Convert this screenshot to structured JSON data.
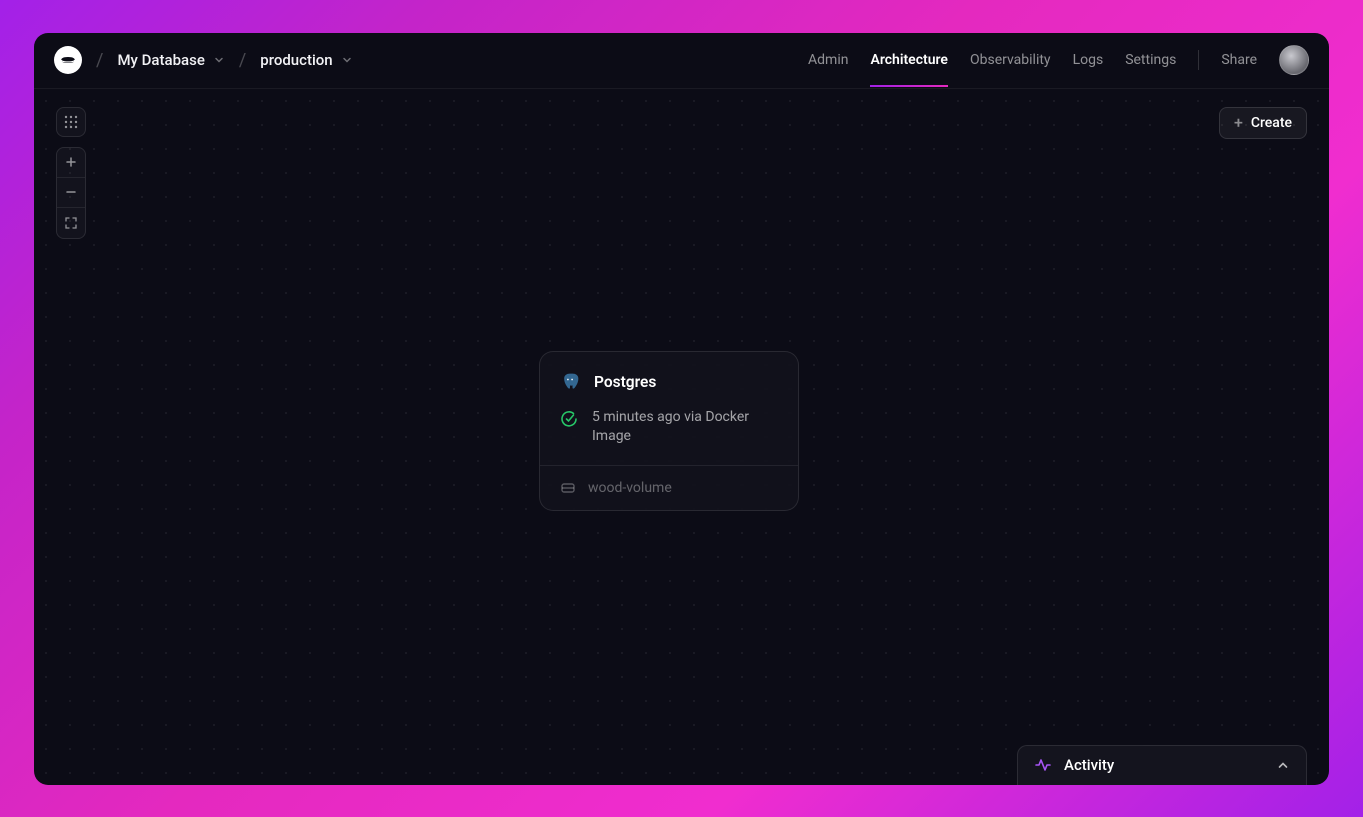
{
  "breadcrumb": {
    "project": "My Database",
    "environment": "production"
  },
  "nav": {
    "admin": "Admin",
    "architecture": "Architecture",
    "observability": "Observability",
    "logs": "Logs",
    "settings": "Settings",
    "share": "Share"
  },
  "toolbar": {
    "create_label": "Create"
  },
  "node": {
    "title": "Postgres",
    "status_text": "5 minutes ago via Docker Image",
    "volume_name": "wood-volume"
  },
  "activity": {
    "label": "Activity"
  }
}
